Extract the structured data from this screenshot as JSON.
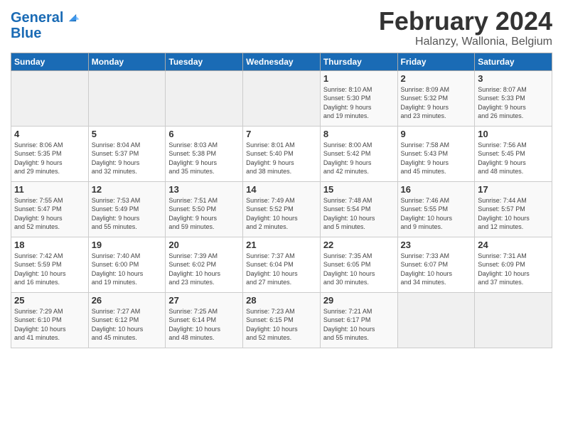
{
  "header": {
    "logo_line1": "General",
    "logo_line2": "Blue",
    "month": "February 2024",
    "location": "Halanzy, Wallonia, Belgium"
  },
  "days_of_week": [
    "Sunday",
    "Monday",
    "Tuesday",
    "Wednesday",
    "Thursday",
    "Friday",
    "Saturday"
  ],
  "weeks": [
    [
      {
        "day": "",
        "info": ""
      },
      {
        "day": "",
        "info": ""
      },
      {
        "day": "",
        "info": ""
      },
      {
        "day": "",
        "info": ""
      },
      {
        "day": "1",
        "info": "Sunrise: 8:10 AM\nSunset: 5:30 PM\nDaylight: 9 hours\nand 19 minutes."
      },
      {
        "day": "2",
        "info": "Sunrise: 8:09 AM\nSunset: 5:32 PM\nDaylight: 9 hours\nand 23 minutes."
      },
      {
        "day": "3",
        "info": "Sunrise: 8:07 AM\nSunset: 5:33 PM\nDaylight: 9 hours\nand 26 minutes."
      }
    ],
    [
      {
        "day": "4",
        "info": "Sunrise: 8:06 AM\nSunset: 5:35 PM\nDaylight: 9 hours\nand 29 minutes."
      },
      {
        "day": "5",
        "info": "Sunrise: 8:04 AM\nSunset: 5:37 PM\nDaylight: 9 hours\nand 32 minutes."
      },
      {
        "day": "6",
        "info": "Sunrise: 8:03 AM\nSunset: 5:38 PM\nDaylight: 9 hours\nand 35 minutes."
      },
      {
        "day": "7",
        "info": "Sunrise: 8:01 AM\nSunset: 5:40 PM\nDaylight: 9 hours\nand 38 minutes."
      },
      {
        "day": "8",
        "info": "Sunrise: 8:00 AM\nSunset: 5:42 PM\nDaylight: 9 hours\nand 42 minutes."
      },
      {
        "day": "9",
        "info": "Sunrise: 7:58 AM\nSunset: 5:43 PM\nDaylight: 9 hours\nand 45 minutes."
      },
      {
        "day": "10",
        "info": "Sunrise: 7:56 AM\nSunset: 5:45 PM\nDaylight: 9 hours\nand 48 minutes."
      }
    ],
    [
      {
        "day": "11",
        "info": "Sunrise: 7:55 AM\nSunset: 5:47 PM\nDaylight: 9 hours\nand 52 minutes."
      },
      {
        "day": "12",
        "info": "Sunrise: 7:53 AM\nSunset: 5:49 PM\nDaylight: 9 hours\nand 55 minutes."
      },
      {
        "day": "13",
        "info": "Sunrise: 7:51 AM\nSunset: 5:50 PM\nDaylight: 9 hours\nand 59 minutes."
      },
      {
        "day": "14",
        "info": "Sunrise: 7:49 AM\nSunset: 5:52 PM\nDaylight: 10 hours\nand 2 minutes."
      },
      {
        "day": "15",
        "info": "Sunrise: 7:48 AM\nSunset: 5:54 PM\nDaylight: 10 hours\nand 5 minutes."
      },
      {
        "day": "16",
        "info": "Sunrise: 7:46 AM\nSunset: 5:55 PM\nDaylight: 10 hours\nand 9 minutes."
      },
      {
        "day": "17",
        "info": "Sunrise: 7:44 AM\nSunset: 5:57 PM\nDaylight: 10 hours\nand 12 minutes."
      }
    ],
    [
      {
        "day": "18",
        "info": "Sunrise: 7:42 AM\nSunset: 5:59 PM\nDaylight: 10 hours\nand 16 minutes."
      },
      {
        "day": "19",
        "info": "Sunrise: 7:40 AM\nSunset: 6:00 PM\nDaylight: 10 hours\nand 19 minutes."
      },
      {
        "day": "20",
        "info": "Sunrise: 7:39 AM\nSunset: 6:02 PM\nDaylight: 10 hours\nand 23 minutes."
      },
      {
        "day": "21",
        "info": "Sunrise: 7:37 AM\nSunset: 6:04 PM\nDaylight: 10 hours\nand 27 minutes."
      },
      {
        "day": "22",
        "info": "Sunrise: 7:35 AM\nSunset: 6:05 PM\nDaylight: 10 hours\nand 30 minutes."
      },
      {
        "day": "23",
        "info": "Sunrise: 7:33 AM\nSunset: 6:07 PM\nDaylight: 10 hours\nand 34 minutes."
      },
      {
        "day": "24",
        "info": "Sunrise: 7:31 AM\nSunset: 6:09 PM\nDaylight: 10 hours\nand 37 minutes."
      }
    ],
    [
      {
        "day": "25",
        "info": "Sunrise: 7:29 AM\nSunset: 6:10 PM\nDaylight: 10 hours\nand 41 minutes."
      },
      {
        "day": "26",
        "info": "Sunrise: 7:27 AM\nSunset: 6:12 PM\nDaylight: 10 hours\nand 45 minutes."
      },
      {
        "day": "27",
        "info": "Sunrise: 7:25 AM\nSunset: 6:14 PM\nDaylight: 10 hours\nand 48 minutes."
      },
      {
        "day": "28",
        "info": "Sunrise: 7:23 AM\nSunset: 6:15 PM\nDaylight: 10 hours\nand 52 minutes."
      },
      {
        "day": "29",
        "info": "Sunrise: 7:21 AM\nSunset: 6:17 PM\nDaylight: 10 hours\nand 55 minutes."
      },
      {
        "day": "",
        "info": ""
      },
      {
        "day": "",
        "info": ""
      }
    ]
  ]
}
